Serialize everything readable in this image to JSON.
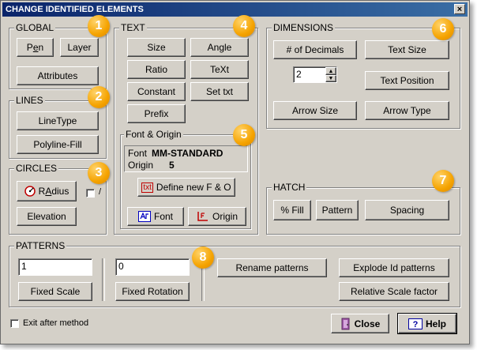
{
  "window": {
    "title": "CHANGE IDENTIFIED ELEMENTS",
    "close": "×"
  },
  "global": {
    "title": "GLOBAL",
    "pen_pre": "P",
    "pen_u": "e",
    "pen_post": "n",
    "layer": "Layer",
    "attributes": "Attributes"
  },
  "lines": {
    "title": "LINES",
    "linetype": "LineType",
    "polyline_fill": "Polyline-Fill"
  },
  "circles": {
    "title": "CIRCLES",
    "radius_pre": "R",
    "radius_u": "A",
    "radius_post": "dius",
    "checkbox_label": "/",
    "elevation": "Elevation"
  },
  "text": {
    "title": "TEXT",
    "size": "Size",
    "angle": "Angle",
    "ratio": "Ratio",
    "text_btn": "TeXt",
    "constant": "Constant",
    "set_txt": "Set txt",
    "prefix": "Prefix"
  },
  "font_origin": {
    "title": "Font & Origin",
    "font_label": "Font",
    "font_value": "MM-STANDARD",
    "origin_label": "Origin",
    "origin_value": "5",
    "define_icon": "txt",
    "define": "Define new F & O",
    "font_btn": "Font",
    "origin_btn": "Origin"
  },
  "dimensions": {
    "title": "DIMENSIONS",
    "decimals": "# of Decimals",
    "decimals_value": "2",
    "text_size": "Text Size",
    "text_position": "Text Position",
    "arrow_size": "Arrow Size",
    "arrow_type": "Arrow Type"
  },
  "hatch": {
    "title": "HATCH",
    "fill": "% Fill",
    "pattern": "Pattern",
    "spacing": "Spacing"
  },
  "patterns": {
    "title": "PATTERNS",
    "scale_value": "1",
    "fixed_scale": "Fixed Scale",
    "rotation_value": "0",
    "fixed_rotation": "Fixed Rotation",
    "rename": "Rename patterns",
    "explode": "Explode Id patterns",
    "relative": "Relative Scale factor"
  },
  "footer": {
    "exit_after": "Exit after method",
    "close": "Close",
    "help": "Help"
  },
  "badges": [
    "1",
    "2",
    "3",
    "4",
    "5",
    "6",
    "7",
    "8"
  ]
}
